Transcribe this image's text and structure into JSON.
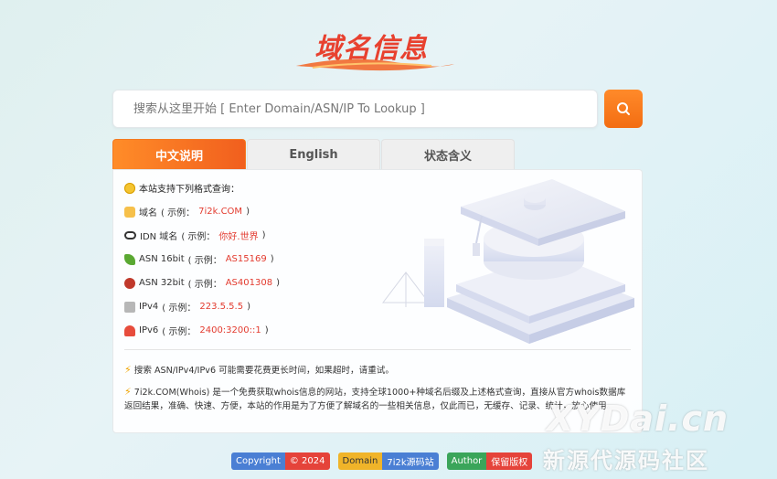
{
  "logo": {
    "text": "域名信息"
  },
  "search": {
    "placeholder": "搜索从这里开始 [ Enter Domain/ASN/IP To Lookup ]"
  },
  "tabs": [
    {
      "label": "中文说明",
      "active": true
    },
    {
      "label": "English",
      "active": false
    },
    {
      "label": "状态含义",
      "active": false
    }
  ],
  "intro": {
    "text": "本站支持下列格式查询："
  },
  "formats": [
    {
      "label": "域名",
      "prefix": "( 示例：",
      "example": "7i2k.COM",
      "suffix": " )",
      "icon": "hand-icon"
    },
    {
      "label": "IDN 域名",
      "prefix": "( 示例：",
      "example": "你好.世界",
      "suffix": " )",
      "icon": "eyes-icon"
    },
    {
      "label": "ASN 16bit",
      "prefix": "( 示例：",
      "example": "AS15169",
      "suffix": " )",
      "icon": "plant-icon"
    },
    {
      "label": "ASN 32bit",
      "prefix": "( 示例：",
      "example": "AS401308",
      "suffix": " )",
      "icon": "gear-icon"
    },
    {
      "label": "IPv4",
      "prefix": "( 示例：",
      "example": "223.5.5.5",
      "suffix": " )",
      "icon": "sign-icon"
    },
    {
      "label": "IPv6",
      "prefix": "( 示例：",
      "example": "2400:3200::1",
      "suffix": " )",
      "icon": "mushroom-icon"
    }
  ],
  "notes": [
    "搜索 ASN/IPv4/IPv6 可能需要花费更长时间，如果超时，请重试。",
    "7i2k.COM(Whois) 是一个免费获取whois信息的网站，支持全球1000+种域名后缀及上述格式查询，直接从官方whois数据库返回结果，准确、快速、方便，本站的作用是为了方便了解域名的一些相关信息，仅此而已，无缓存、记录、统计，放心使用。"
  ],
  "badges": [
    {
      "left": "Copyright",
      "right": "© 2024",
      "left_color": "#4a7fd4",
      "right_color": "#e5433a"
    },
    {
      "left": "Domain",
      "right": "7i2k源码站",
      "left_color": "#f0b429",
      "right_color": "#4a7fd4"
    },
    {
      "left": "Author",
      "right": "保留版权",
      "left_color": "#3aa55a",
      "right_color": "#e5433a"
    }
  ],
  "watermark": {
    "line1": "XYDai.cn",
    "line2": "新源代源码社区"
  },
  "colors": {
    "accent": "#f36d12",
    "example": "#e33b2f"
  }
}
